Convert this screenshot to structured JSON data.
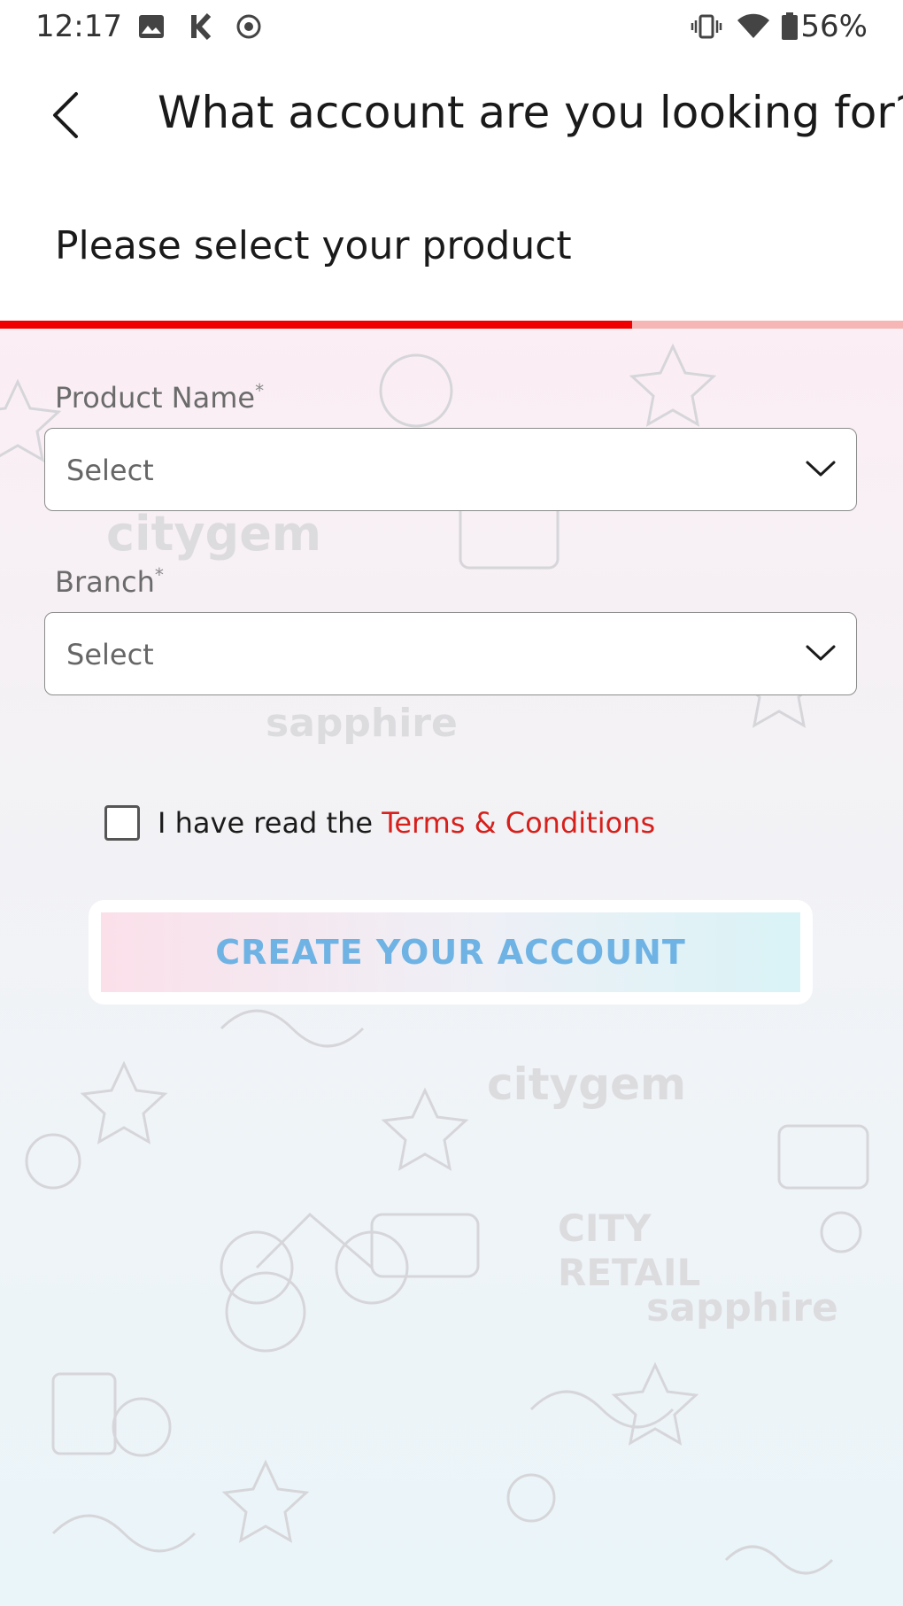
{
  "status_bar": {
    "time": "12:17",
    "battery": "56%",
    "icons": [
      "image-icon",
      "k-app-icon",
      "record-icon",
      "vibrate-icon",
      "wifi-icon",
      "battery-icon"
    ]
  },
  "header": {
    "title": "What account are you looking for?",
    "back_icon": "chevron-left-icon"
  },
  "subtitle": "Please select your product",
  "progress": {
    "value": 0.7,
    "fill_color": "#f00000",
    "track_color": "#f7b6b6"
  },
  "form": {
    "product": {
      "label": "Product Name",
      "required_mark": "*",
      "value": "Select"
    },
    "branch": {
      "label": "Branch",
      "required_mark": "*",
      "value": "Select"
    },
    "terms": {
      "prefix": "I have read the ",
      "link": "Terms & Conditions",
      "checked": false
    },
    "submit_label": "CREATE YOUR ACCOUNT"
  },
  "colors": {
    "accent_red": "#d6201c",
    "button_text": "#6fb3e4"
  }
}
